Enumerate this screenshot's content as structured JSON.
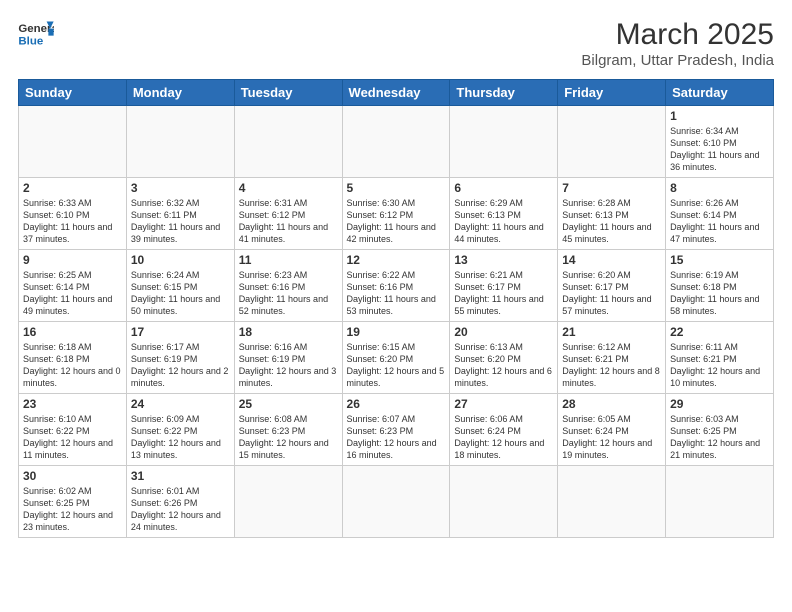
{
  "header": {
    "logo_general": "General",
    "logo_blue": "Blue",
    "title": "March 2025",
    "subtitle": "Bilgram, Uttar Pradesh, India"
  },
  "weekdays": [
    "Sunday",
    "Monday",
    "Tuesday",
    "Wednesday",
    "Thursday",
    "Friday",
    "Saturday"
  ],
  "weeks": [
    [
      {
        "day": "",
        "info": ""
      },
      {
        "day": "",
        "info": ""
      },
      {
        "day": "",
        "info": ""
      },
      {
        "day": "",
        "info": ""
      },
      {
        "day": "",
        "info": ""
      },
      {
        "day": "",
        "info": ""
      },
      {
        "day": "1",
        "info": "Sunrise: 6:34 AM\nSunset: 6:10 PM\nDaylight: 11 hours\nand 36 minutes."
      }
    ],
    [
      {
        "day": "2",
        "info": "Sunrise: 6:33 AM\nSunset: 6:10 PM\nDaylight: 11 hours\nand 37 minutes."
      },
      {
        "day": "3",
        "info": "Sunrise: 6:32 AM\nSunset: 6:11 PM\nDaylight: 11 hours\nand 39 minutes."
      },
      {
        "day": "4",
        "info": "Sunrise: 6:31 AM\nSunset: 6:12 PM\nDaylight: 11 hours\nand 41 minutes."
      },
      {
        "day": "5",
        "info": "Sunrise: 6:30 AM\nSunset: 6:12 PM\nDaylight: 11 hours\nand 42 minutes."
      },
      {
        "day": "6",
        "info": "Sunrise: 6:29 AM\nSunset: 6:13 PM\nDaylight: 11 hours\nand 44 minutes."
      },
      {
        "day": "7",
        "info": "Sunrise: 6:28 AM\nSunset: 6:13 PM\nDaylight: 11 hours\nand 45 minutes."
      },
      {
        "day": "8",
        "info": "Sunrise: 6:26 AM\nSunset: 6:14 PM\nDaylight: 11 hours\nand 47 minutes."
      }
    ],
    [
      {
        "day": "9",
        "info": "Sunrise: 6:25 AM\nSunset: 6:14 PM\nDaylight: 11 hours\nand 49 minutes."
      },
      {
        "day": "10",
        "info": "Sunrise: 6:24 AM\nSunset: 6:15 PM\nDaylight: 11 hours\nand 50 minutes."
      },
      {
        "day": "11",
        "info": "Sunrise: 6:23 AM\nSunset: 6:16 PM\nDaylight: 11 hours\nand 52 minutes."
      },
      {
        "day": "12",
        "info": "Sunrise: 6:22 AM\nSunset: 6:16 PM\nDaylight: 11 hours\nand 53 minutes."
      },
      {
        "day": "13",
        "info": "Sunrise: 6:21 AM\nSunset: 6:17 PM\nDaylight: 11 hours\nand 55 minutes."
      },
      {
        "day": "14",
        "info": "Sunrise: 6:20 AM\nSunset: 6:17 PM\nDaylight: 11 hours\nand 57 minutes."
      },
      {
        "day": "15",
        "info": "Sunrise: 6:19 AM\nSunset: 6:18 PM\nDaylight: 11 hours\nand 58 minutes."
      }
    ],
    [
      {
        "day": "16",
        "info": "Sunrise: 6:18 AM\nSunset: 6:18 PM\nDaylight: 12 hours\nand 0 minutes."
      },
      {
        "day": "17",
        "info": "Sunrise: 6:17 AM\nSunset: 6:19 PM\nDaylight: 12 hours\nand 2 minutes."
      },
      {
        "day": "18",
        "info": "Sunrise: 6:16 AM\nSunset: 6:19 PM\nDaylight: 12 hours\nand 3 minutes."
      },
      {
        "day": "19",
        "info": "Sunrise: 6:15 AM\nSunset: 6:20 PM\nDaylight: 12 hours\nand 5 minutes."
      },
      {
        "day": "20",
        "info": "Sunrise: 6:13 AM\nSunset: 6:20 PM\nDaylight: 12 hours\nand 6 minutes."
      },
      {
        "day": "21",
        "info": "Sunrise: 6:12 AM\nSunset: 6:21 PM\nDaylight: 12 hours\nand 8 minutes."
      },
      {
        "day": "22",
        "info": "Sunrise: 6:11 AM\nSunset: 6:21 PM\nDaylight: 12 hours\nand 10 minutes."
      }
    ],
    [
      {
        "day": "23",
        "info": "Sunrise: 6:10 AM\nSunset: 6:22 PM\nDaylight: 12 hours\nand 11 minutes."
      },
      {
        "day": "24",
        "info": "Sunrise: 6:09 AM\nSunset: 6:22 PM\nDaylight: 12 hours\nand 13 minutes."
      },
      {
        "day": "25",
        "info": "Sunrise: 6:08 AM\nSunset: 6:23 PM\nDaylight: 12 hours\nand 15 minutes."
      },
      {
        "day": "26",
        "info": "Sunrise: 6:07 AM\nSunset: 6:23 PM\nDaylight: 12 hours\nand 16 minutes."
      },
      {
        "day": "27",
        "info": "Sunrise: 6:06 AM\nSunset: 6:24 PM\nDaylight: 12 hours\nand 18 minutes."
      },
      {
        "day": "28",
        "info": "Sunrise: 6:05 AM\nSunset: 6:24 PM\nDaylight: 12 hours\nand 19 minutes."
      },
      {
        "day": "29",
        "info": "Sunrise: 6:03 AM\nSunset: 6:25 PM\nDaylight: 12 hours\nand 21 minutes."
      }
    ],
    [
      {
        "day": "30",
        "info": "Sunrise: 6:02 AM\nSunset: 6:25 PM\nDaylight: 12 hours\nand 23 minutes."
      },
      {
        "day": "31",
        "info": "Sunrise: 6:01 AM\nSunset: 6:26 PM\nDaylight: 12 hours\nand 24 minutes."
      },
      {
        "day": "",
        "info": ""
      },
      {
        "day": "",
        "info": ""
      },
      {
        "day": "",
        "info": ""
      },
      {
        "day": "",
        "info": ""
      },
      {
        "day": "",
        "info": ""
      }
    ]
  ]
}
